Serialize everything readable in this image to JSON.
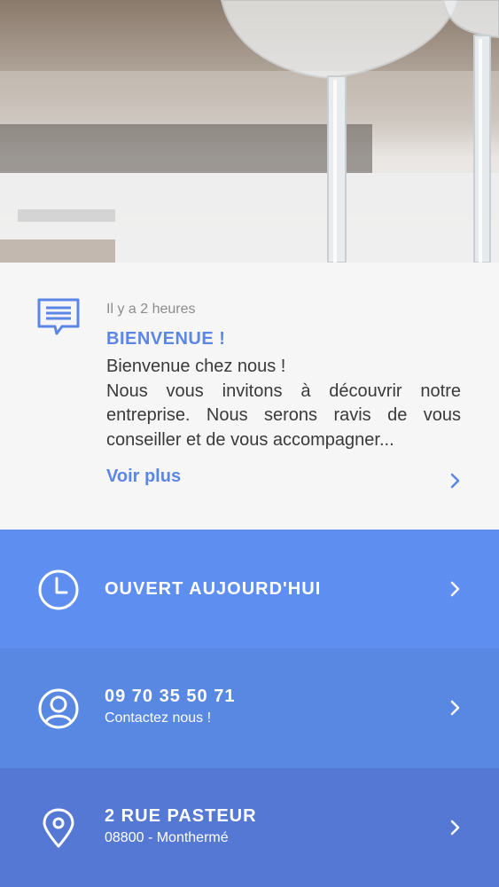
{
  "news": {
    "time": "Il y a 2 heures",
    "title": "BIENVENUE !",
    "body_lines": [
      "Bienvenue chez nous !",
      "Nous vous invitons à découvrir notre entreprise. Nous serons ravis de vous conseiller et de vous accompagner..."
    ],
    "more_label": "Voir plus",
    "icon": "message-icon"
  },
  "hours": {
    "title": "OUVERT AUJOURD'HUI",
    "icon": "clock-icon"
  },
  "contact": {
    "title": "09 70 35 50 71",
    "subtitle": "Contactez nous !",
    "icon": "user-icon"
  },
  "address": {
    "title": "2 RUE PASTEUR",
    "subtitle": "08800 - Monthermé",
    "icon": "location-pin-icon"
  },
  "colors": {
    "accent": "#5b86e6",
    "row1": "#5f8ef1",
    "row2": "#5888e2",
    "row3": "#5478d3"
  }
}
